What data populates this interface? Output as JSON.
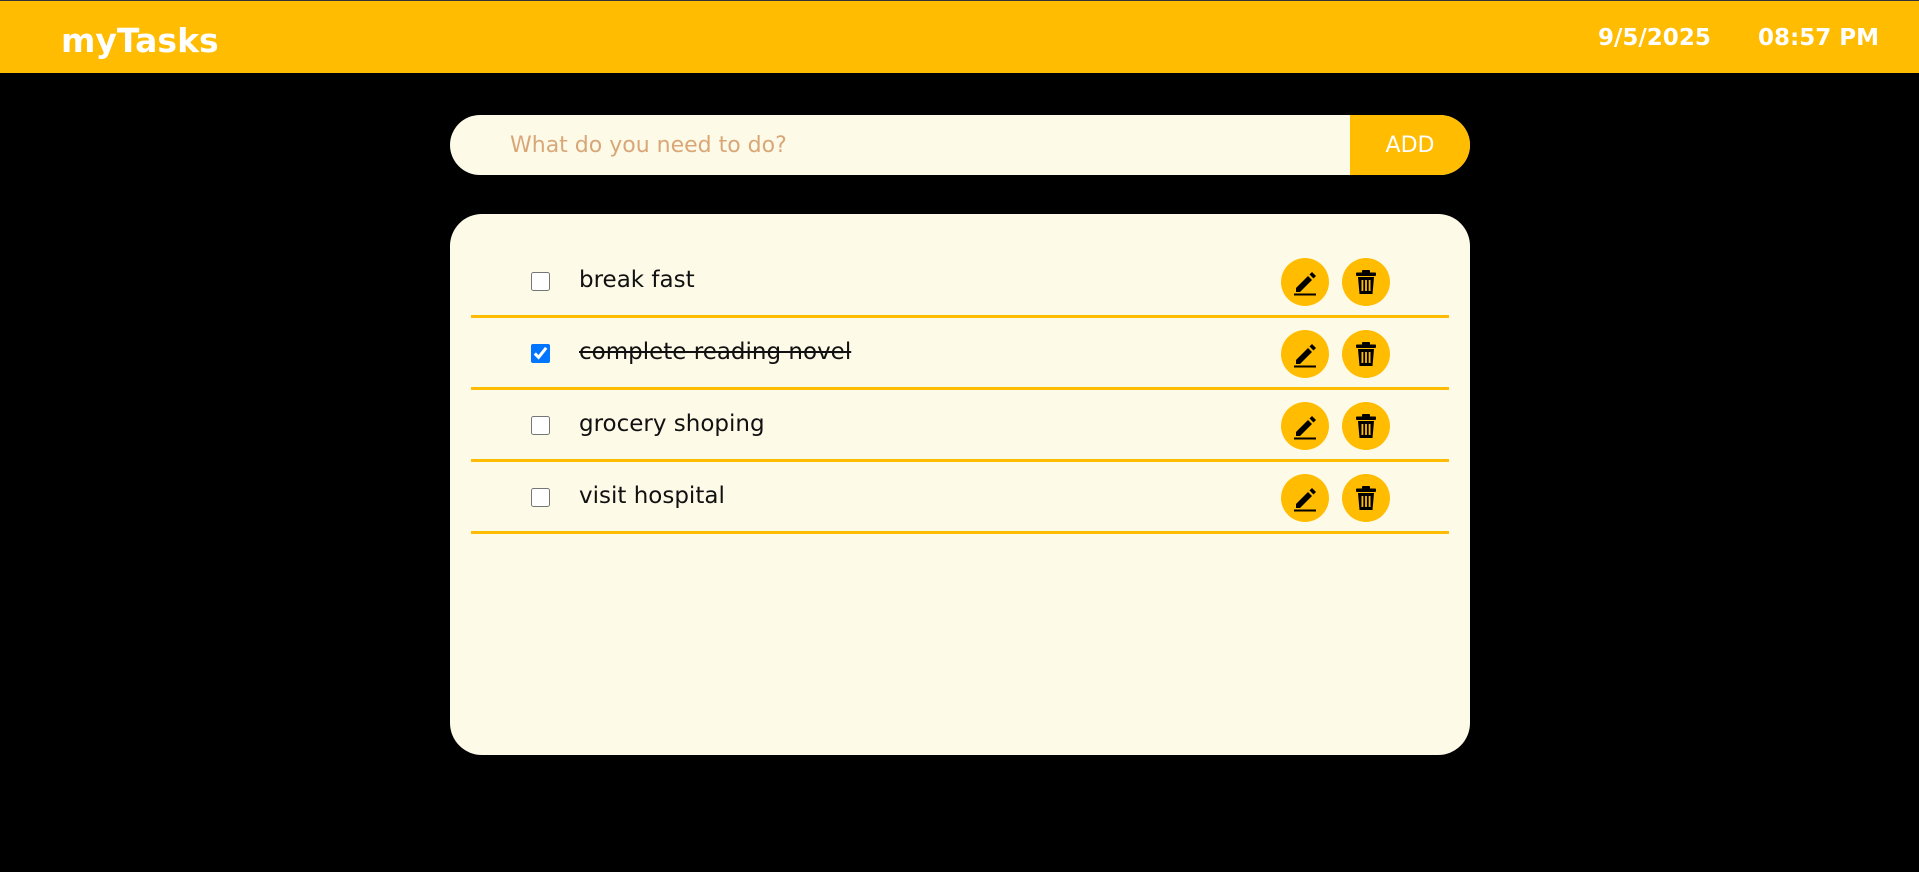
{
  "header": {
    "brand": "myTasks",
    "date": "9/5/2025",
    "time": "08:57 PM"
  },
  "add_form": {
    "placeholder": "What do you need to do?",
    "value": "",
    "button_label": "ADD"
  },
  "tasks": [
    {
      "label": "break fast",
      "checked": false
    },
    {
      "label": "complete reading novel",
      "checked": true
    },
    {
      "label": "grocery shoping",
      "checked": false
    },
    {
      "label": "visit hospital",
      "checked": false
    }
  ],
  "icons": {
    "edit": "pencil-icon",
    "delete": "trash-icon"
  },
  "colors": {
    "accent": "#FFBC00",
    "panel": "#FEFAE8",
    "background": "#000000",
    "placeholder": "#D9A777",
    "checkbox": "#0075FF"
  }
}
